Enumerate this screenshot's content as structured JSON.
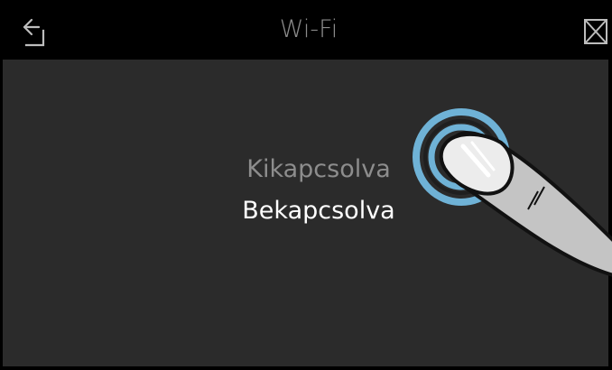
{
  "header": {
    "title": "Wi-Fi",
    "back_icon": "back-arrow-icon",
    "close_icon": "close-icon"
  },
  "options": [
    {
      "label": "Kikapcsolva",
      "selected": false
    },
    {
      "label": "Bekapcsolva",
      "selected": true
    }
  ],
  "colors": {
    "background": "#2b2b2b",
    "header": "#000000",
    "selected_text": "#ffffff",
    "unselected_text": "#8d8d8d",
    "tap_ring": "#6fb2d6"
  },
  "overlay": {
    "icon": "tap-gesture-finger-icon"
  }
}
